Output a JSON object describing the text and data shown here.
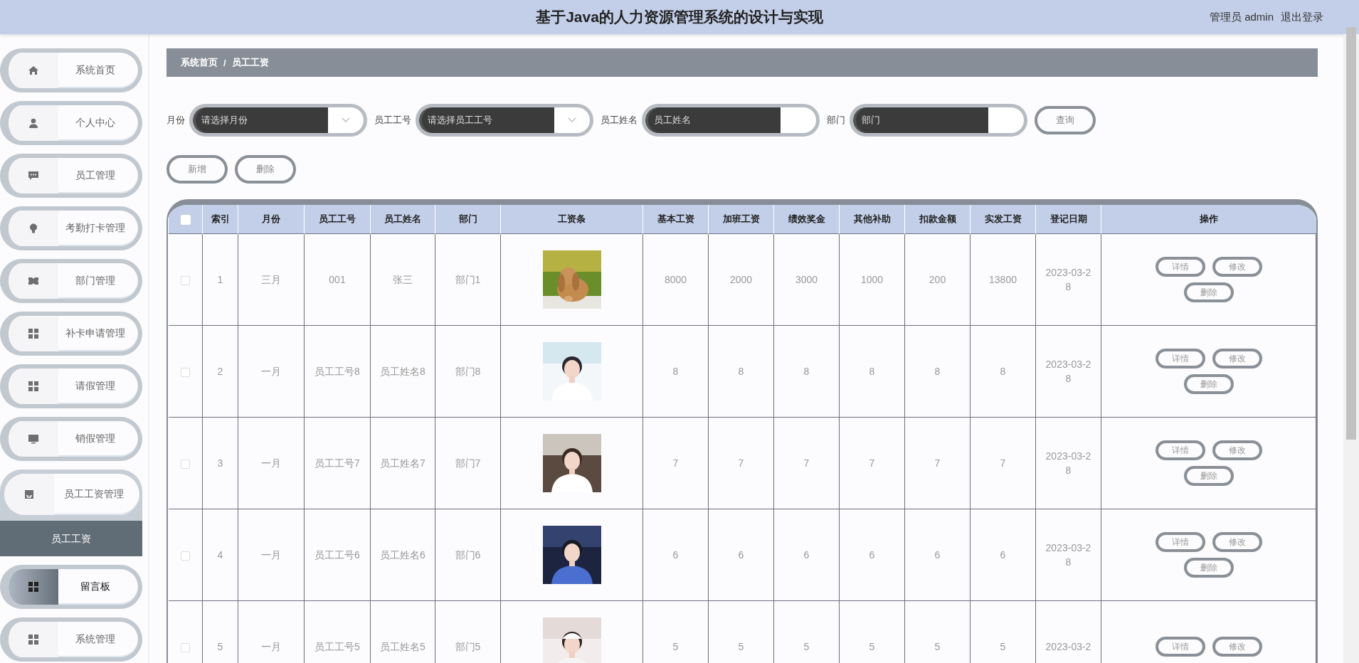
{
  "header": {
    "title": "基于Java的人力资源管理系统的设计与实现",
    "user": "管理员 admin",
    "logout": "退出登录"
  },
  "sidebar": {
    "items": [
      {
        "label": "系统首页",
        "selected": false,
        "hovered": false
      },
      {
        "label": "个人中心",
        "selected": false,
        "hovered": false
      },
      {
        "label": "员工管理",
        "selected": false,
        "hovered": false
      },
      {
        "label": "考勤打卡管理",
        "selected": false,
        "hovered": false
      },
      {
        "label": "部门管理",
        "selected": false,
        "hovered": false
      },
      {
        "label": "补卡申请管理",
        "selected": false,
        "hovered": false
      },
      {
        "label": "请假管理",
        "selected": false,
        "hovered": false
      },
      {
        "label": "销假管理",
        "selected": false,
        "hovered": false
      },
      {
        "label": "员工工资管理",
        "selected": false,
        "hovered": false,
        "expanded": true,
        "children": [
          {
            "label": "员工工资",
            "selected": true
          }
        ]
      },
      {
        "label": "留言板",
        "selected": false,
        "hovered": true
      },
      {
        "label": "系统管理",
        "selected": false,
        "hovered": false
      }
    ]
  },
  "breadcrumb": {
    "items": [
      "系统首页",
      "员工工资"
    ],
    "separator": "/"
  },
  "search": {
    "fields": [
      {
        "label": "月份",
        "placeholder": "请选择月份",
        "kind": "select"
      },
      {
        "label": "员工工号",
        "placeholder": "请选择员工工号",
        "kind": "select"
      },
      {
        "label": "员工姓名",
        "placeholder": "员工姓名",
        "kind": "input"
      },
      {
        "label": "部门",
        "placeholder": "部门",
        "kind": "input"
      }
    ],
    "button": "查询"
  },
  "actions": [
    "新增",
    "删除"
  ],
  "table": {
    "select_all_checked": false,
    "columns": [
      "索引",
      "月份",
      "员工工号",
      "员工姓名",
      "部门",
      "工资条",
      "基本工资",
      "加班工资",
      "绩效奖金",
      "其他补助",
      "扣款金额",
      "实发工资",
      "登记日期",
      "操作"
    ],
    "rows": [
      {
        "checked": false,
        "cells": [
          "1",
          "三月",
          "001",
          "张三",
          "部门1"
        ],
        "picture": {
          "kind": "picture"
        },
        "amounts": [
          "8000",
          "2000",
          "3000",
          "1000",
          "200",
          "13800"
        ],
        "date": "2023-03-28",
        "buttons": [
          "详情",
          "修改",
          "删除"
        ]
      },
      {
        "checked": false,
        "cells": [
          "2",
          "一月",
          "员工工号8",
          "员工姓名8",
          "部门8"
        ],
        "picture": {
          "kind": "picture"
        },
        "amounts": [
          "8",
          "8",
          "8",
          "8",
          "8",
          "8"
        ],
        "date": "2023-03-28",
        "buttons": [
          "详情",
          "修改",
          "删除"
        ]
      },
      {
        "checked": false,
        "cells": [
          "3",
          "一月",
          "员工工号7",
          "员工姓名7",
          "部门7"
        ],
        "picture": {
          "kind": "picture"
        },
        "amounts": [
          "7",
          "7",
          "7",
          "7",
          "7",
          "7"
        ],
        "date": "2023-03-28",
        "buttons": [
          "详情",
          "修改",
          "删除"
        ]
      },
      {
        "checked": false,
        "cells": [
          "4",
          "一月",
          "员工工号6",
          "员工姓名6",
          "部门6"
        ],
        "picture": {
          "kind": "picture"
        },
        "amounts": [
          "6",
          "6",
          "6",
          "6",
          "6",
          "6"
        ],
        "date": "2023-03-28",
        "buttons": [
          "详情",
          "修改",
          "删除"
        ]
      },
      {
        "checked": false,
        "cells": [
          "5",
          "一月",
          "员工工号5",
          "员工姓名5",
          "部门5"
        ],
        "picture": {
          "kind": "picture"
        },
        "amounts": [
          "5",
          "5",
          "5",
          "5",
          "5",
          "5"
        ],
        "date": "2023-03-2",
        "buttons": [
          "详情",
          "修改"
        ]
      }
    ]
  }
}
